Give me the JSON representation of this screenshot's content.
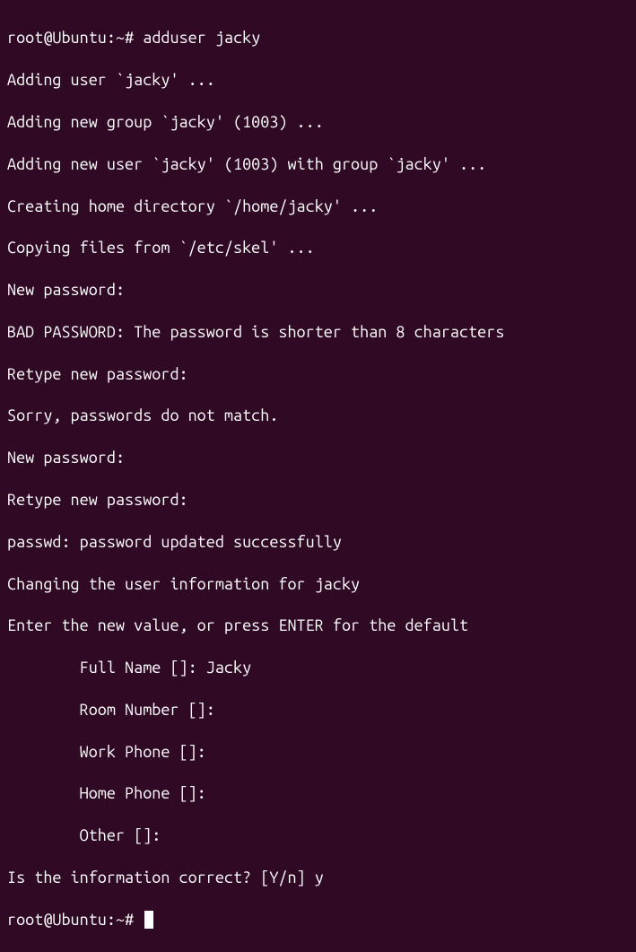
{
  "prompt1": {
    "user": "root@Ubuntu",
    "path": "~",
    "symbol": "#",
    "command": "adduser jacky"
  },
  "output": {
    "line1": "Adding user `jacky' ...",
    "line2": "Adding new group `jacky' (1003) ...",
    "line3": "Adding new user `jacky' (1003) with group `jacky' ...",
    "line4": "Creating home directory `/home/jacky' ...",
    "line5": "Copying files from `/etc/skel' ...",
    "line6": "New password:",
    "line7": "BAD PASSWORD: The password is shorter than 8 characters",
    "line8": "Retype new password:",
    "line9": "Sorry, passwords do not match.",
    "line10": "New password:",
    "line11": "Retype new password:",
    "line12": "passwd: password updated successfully",
    "line13": "Changing the user information for jacky",
    "line14": "Enter the new value, or press ENTER for the default",
    "line15": "        Full Name []: Jacky",
    "line16": "        Room Number []:",
    "line17": "        Work Phone []:",
    "line18": "        Home Phone []:",
    "line19": "        Other []:",
    "line20": "Is the information correct? [Y/n] y"
  },
  "prompt2": {
    "user": "root@Ubuntu",
    "path": "~",
    "symbol": "#"
  }
}
